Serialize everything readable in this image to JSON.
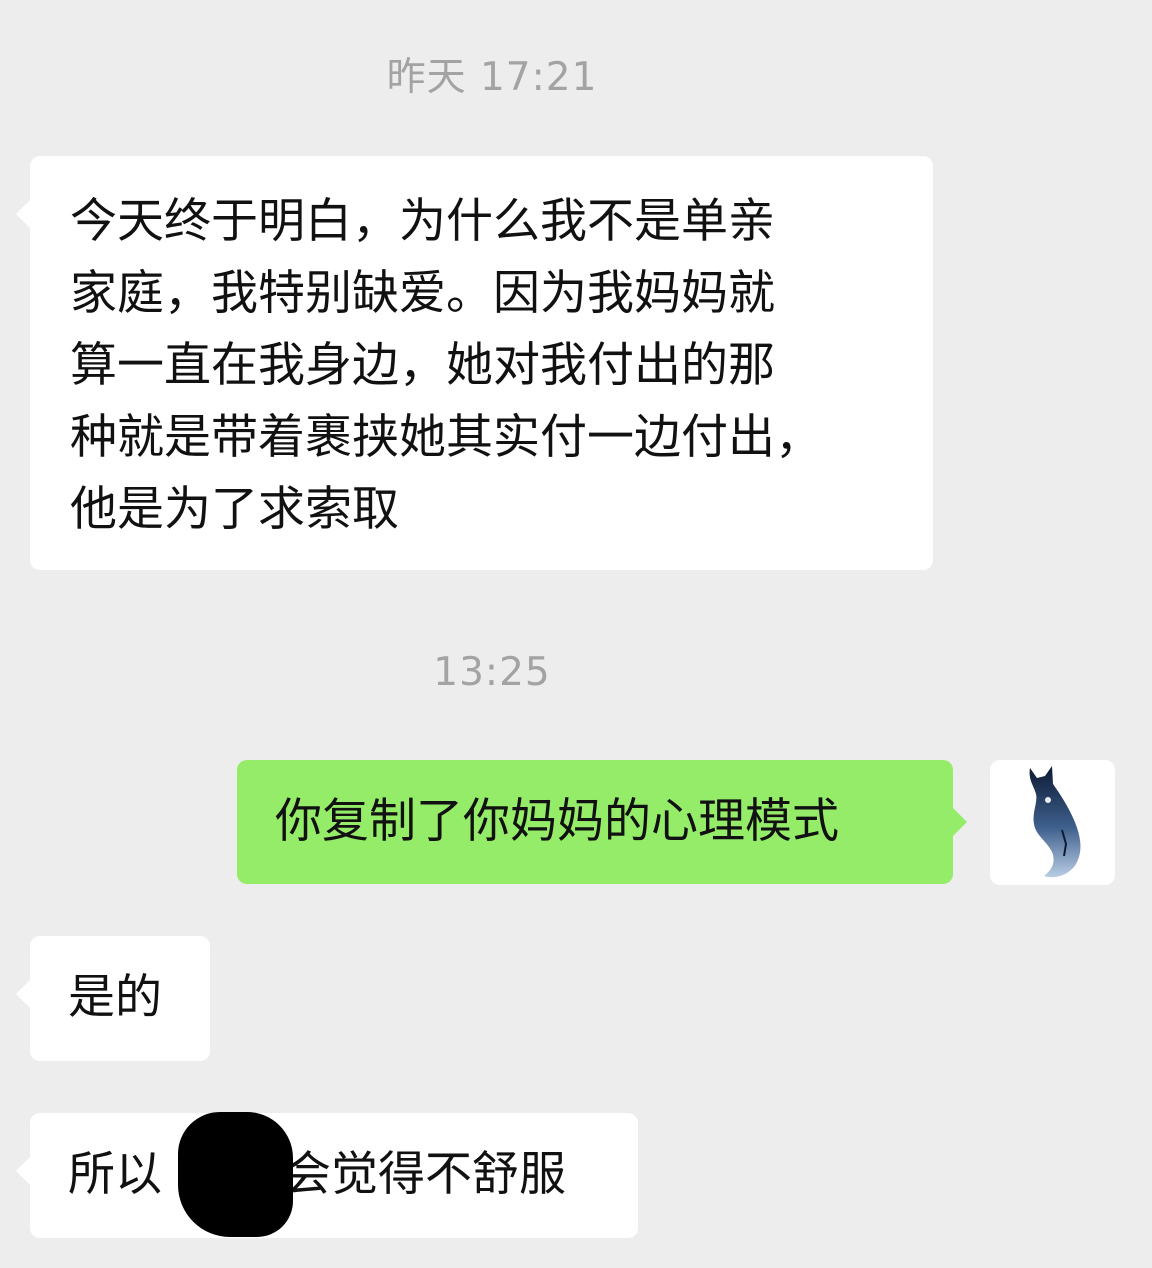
{
  "timestamps": {
    "first": "昨天 17:21",
    "second": "13:25"
  },
  "messages": [
    {
      "side": "left",
      "lines": [
        "今天终于明白，为什么我不是单亲",
        "家庭，我特别缺爱。因为我妈妈就",
        "算一直在我身边，她对我付出的那",
        "种就是带着裹挟她其实付一边付出，",
        "他是为了求索取"
      ]
    },
    {
      "side": "right",
      "text": "你复制了你妈妈的心理模式",
      "avatar_icon": "cat-silhouette-avatar-icon"
    },
    {
      "side": "left",
      "text": "是的"
    },
    {
      "side": "left",
      "text_before": "所以",
      "text_after": "会觉得不舒服",
      "redaction": "black-scribble"
    }
  ],
  "colors": {
    "background": "#ededed",
    "incoming_bubble": "#ffffff",
    "outgoing_bubble": "#95ec69",
    "timestamp_text": "#a3a3a3"
  }
}
